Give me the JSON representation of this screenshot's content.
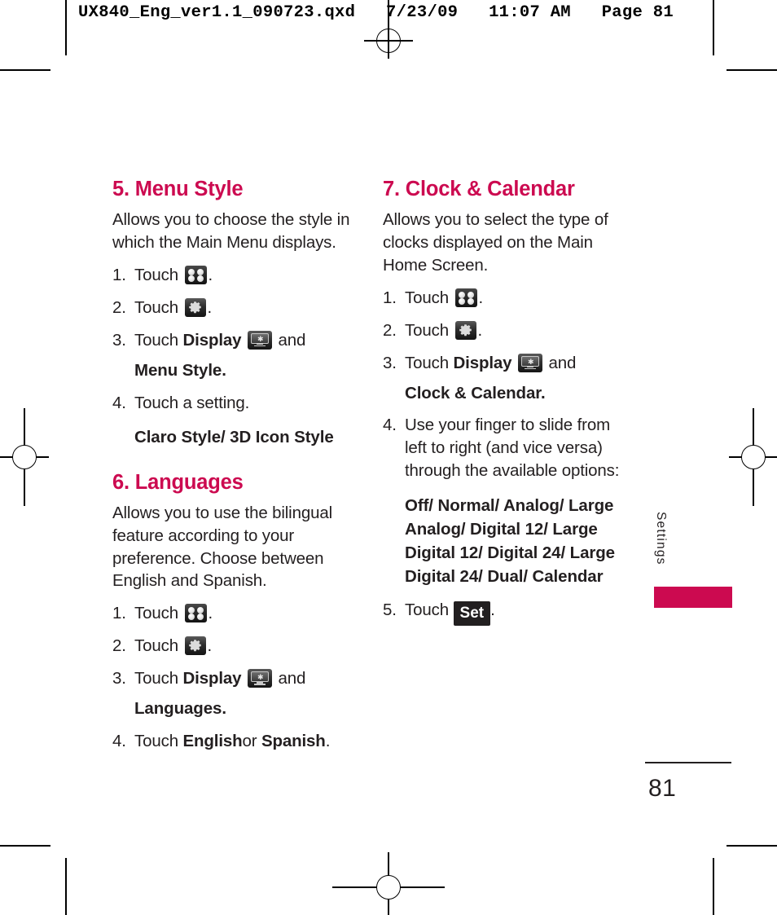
{
  "print_slug": "UX840_Eng_ver1.1_090723.qxd   7/23/09   11:07 AM   Page 81",
  "accent_color": "#cc0a50",
  "side_tab": {
    "label": "Settings"
  },
  "folio": {
    "page_number": "81"
  },
  "left_column": [
    {
      "title": "5. Menu Style",
      "intro": "Allows you to choose the style in which the Main Menu displays.",
      "steps": [
        {
          "num": "1.",
          "pre": "Touch",
          "icon": "menu-grid-icon",
          "post": "."
        },
        {
          "num": "2.",
          "pre": "Touch",
          "icon": "gear-icon",
          "post": "."
        },
        {
          "num": "3.",
          "pre": "Touch",
          "bold_before": "Display",
          "icon": "display-icon",
          "mid": "and",
          "bold_after": "Menu Style",
          "post": "."
        },
        {
          "num": "4.",
          "pre": "Touch a setting.",
          "options": "Claro Style/ 3D Icon Style"
        }
      ]
    },
    {
      "title": "6. Languages",
      "intro": "Allows you to use the bilingual feature according to your preference. Choose between English and Spanish.",
      "steps": [
        {
          "num": "1.",
          "pre": "Touch",
          "icon": "menu-grid-icon",
          "post": "."
        },
        {
          "num": "2.",
          "pre": "Touch",
          "icon": "gear-icon",
          "post": "."
        },
        {
          "num": "3.",
          "pre": "Touch",
          "bold_before": "Display",
          "icon": "display-icon",
          "mid": "and",
          "bold_after": "Languages",
          "post": "."
        },
        {
          "num": "4.",
          "pre": "Touch",
          "bold_before": "English",
          "mid": "or",
          "bold_after": "Spanish",
          "post": "."
        }
      ]
    }
  ],
  "right_column": [
    {
      "title": "7. Clock & Calendar",
      "intro": "Allows you to select the type of clocks displayed on the Main Home Screen.",
      "steps": [
        {
          "num": "1.",
          "pre": "Touch",
          "icon": "menu-grid-icon",
          "post": "."
        },
        {
          "num": "2.",
          "pre": "Touch",
          "icon": "gear-icon",
          "post": "."
        },
        {
          "num": "3.",
          "pre": "Touch",
          "bold_before": "Display",
          "icon": "display-icon",
          "mid": "and",
          "bold_after": "Clock & Calendar",
          "post": "."
        },
        {
          "num": "4.",
          "pre": "Use your finger to slide from left to right (and vice versa) through the available options:",
          "options": "Off/ Normal/ Analog/ Large Analog/ Digital 12/ Large Digital 12/ Digital 24/ Large Digital 24/ Dual/ Calendar"
        },
        {
          "num": "5.",
          "pre": "Touch",
          "chip": "Set",
          "post": "."
        }
      ]
    }
  ]
}
